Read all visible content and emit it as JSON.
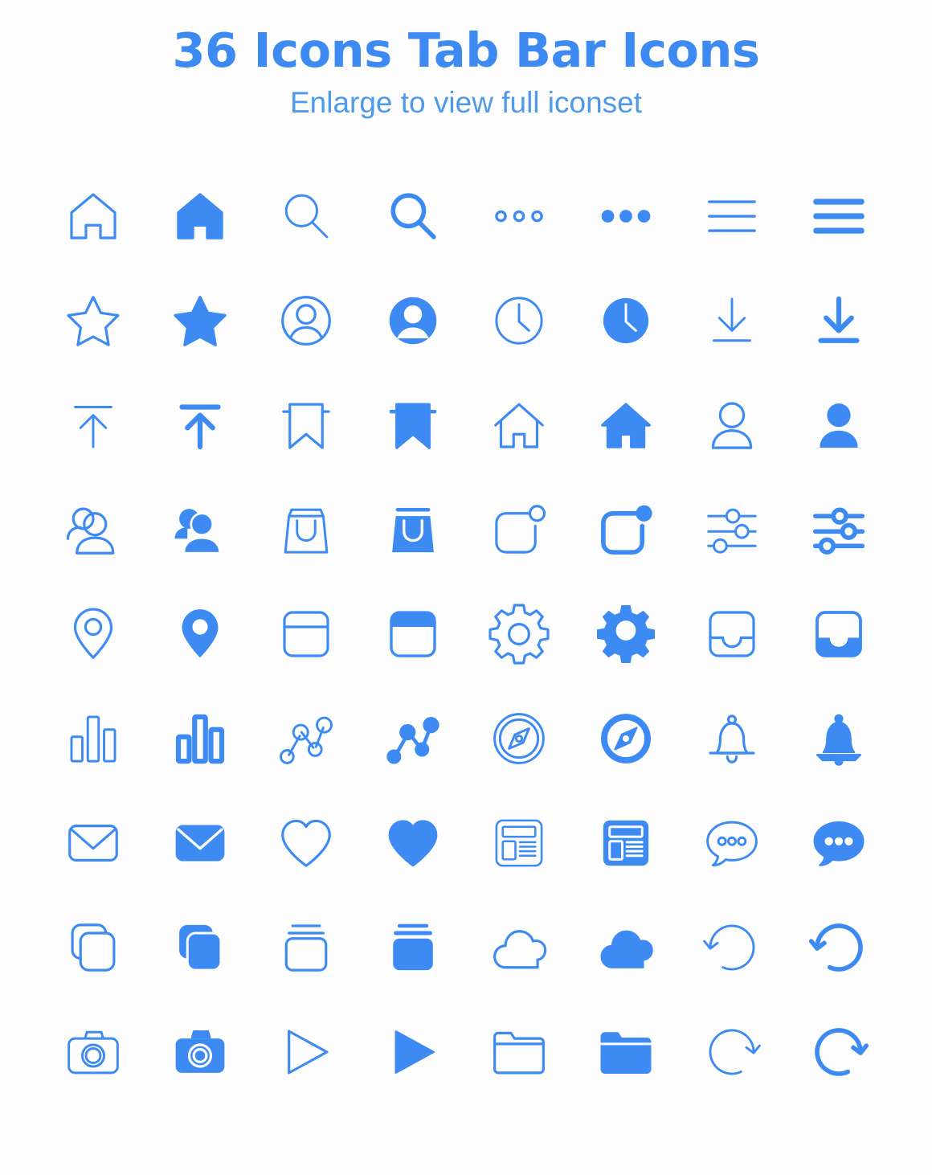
{
  "header": {
    "title": "36 Icons Tab Bar Icons",
    "subtitle": "Enlarge to view full iconset"
  },
  "theme": {
    "accent": "#3d8bf2",
    "accent_light": "#4f9ae8",
    "background": "#fdfdfe"
  },
  "grid": {
    "columns": 8,
    "rows": 9,
    "total_icons": 72,
    "icon_concepts": 36,
    "styles": [
      "outline",
      "filled"
    ]
  },
  "icons": [
    {
      "name": "home-icon",
      "label": "Home",
      "style": "outline"
    },
    {
      "name": "home-icon",
      "label": "Home",
      "style": "filled"
    },
    {
      "name": "search-icon",
      "label": "Search",
      "style": "outline"
    },
    {
      "name": "search-icon",
      "label": "Search",
      "style": "filled"
    },
    {
      "name": "more-horizontal-icon",
      "label": "More",
      "style": "outline"
    },
    {
      "name": "more-horizontal-icon",
      "label": "More",
      "style": "filled"
    },
    {
      "name": "menu-icon",
      "label": "Menu",
      "style": "outline"
    },
    {
      "name": "menu-icon",
      "label": "Menu",
      "style": "filled"
    },
    {
      "name": "star-icon",
      "label": "Star",
      "style": "outline"
    },
    {
      "name": "star-icon",
      "label": "Star",
      "style": "filled"
    },
    {
      "name": "account-circle-icon",
      "label": "Account",
      "style": "outline"
    },
    {
      "name": "account-circle-icon",
      "label": "Account",
      "style": "filled"
    },
    {
      "name": "clock-icon",
      "label": "Clock",
      "style": "outline"
    },
    {
      "name": "clock-icon",
      "label": "Clock",
      "style": "filled"
    },
    {
      "name": "download-icon",
      "label": "Download",
      "style": "outline"
    },
    {
      "name": "download-icon",
      "label": "Download",
      "style": "filled"
    },
    {
      "name": "upload-icon",
      "label": "Upload",
      "style": "outline"
    },
    {
      "name": "upload-icon",
      "label": "Upload",
      "style": "filled"
    },
    {
      "name": "bookmark-icon",
      "label": "Bookmark",
      "style": "outline"
    },
    {
      "name": "bookmark-icon",
      "label": "Bookmark",
      "style": "filled"
    },
    {
      "name": "house-roof-icon",
      "label": "House",
      "style": "outline"
    },
    {
      "name": "house-roof-icon",
      "label": "House",
      "style": "filled"
    },
    {
      "name": "person-icon",
      "label": "Person",
      "style": "outline"
    },
    {
      "name": "person-icon",
      "label": "Person",
      "style": "filled"
    },
    {
      "name": "people-group-icon",
      "label": "People",
      "style": "outline"
    },
    {
      "name": "people-group-icon",
      "label": "People",
      "style": "filled"
    },
    {
      "name": "shopping-bag-icon",
      "label": "Shopping Bag",
      "style": "outline"
    },
    {
      "name": "shopping-bag-icon",
      "label": "Shopping Bag",
      "style": "filled"
    },
    {
      "name": "notification-badge-icon",
      "label": "Notification Badge",
      "style": "outline"
    },
    {
      "name": "notification-badge-icon",
      "label": "Notification Badge",
      "style": "filled"
    },
    {
      "name": "sliders-icon",
      "label": "Settings Sliders",
      "style": "outline"
    },
    {
      "name": "sliders-icon",
      "label": "Settings Sliders",
      "style": "filled"
    },
    {
      "name": "map-pin-icon",
      "label": "Location",
      "style": "outline"
    },
    {
      "name": "map-pin-icon",
      "label": "Location",
      "style": "filled"
    },
    {
      "name": "calendar-icon",
      "label": "Calendar",
      "style": "outline"
    },
    {
      "name": "calendar-icon",
      "label": "Calendar",
      "style": "filled"
    },
    {
      "name": "gear-icon",
      "label": "Settings",
      "style": "outline"
    },
    {
      "name": "gear-icon",
      "label": "Settings",
      "style": "filled"
    },
    {
      "name": "inbox-icon",
      "label": "Inbox",
      "style": "outline"
    },
    {
      "name": "inbox-icon",
      "label": "Inbox",
      "style": "filled"
    },
    {
      "name": "bar-chart-icon",
      "label": "Statistics",
      "style": "outline"
    },
    {
      "name": "bar-chart-icon",
      "label": "Statistics",
      "style": "filled"
    },
    {
      "name": "network-nodes-icon",
      "label": "Network",
      "style": "outline"
    },
    {
      "name": "network-nodes-icon",
      "label": "Network",
      "style": "filled"
    },
    {
      "name": "compass-icon",
      "label": "Explore",
      "style": "outline"
    },
    {
      "name": "compass-icon",
      "label": "Explore",
      "style": "filled"
    },
    {
      "name": "bell-icon",
      "label": "Notifications",
      "style": "outline"
    },
    {
      "name": "bell-icon",
      "label": "Notifications",
      "style": "filled"
    },
    {
      "name": "mail-icon",
      "label": "Mail",
      "style": "outline"
    },
    {
      "name": "mail-icon",
      "label": "Mail",
      "style": "filled"
    },
    {
      "name": "heart-icon",
      "label": "Favorite",
      "style": "outline"
    },
    {
      "name": "heart-icon",
      "label": "Favorite",
      "style": "filled"
    },
    {
      "name": "news-article-icon",
      "label": "News",
      "style": "outline"
    },
    {
      "name": "news-article-icon",
      "label": "News",
      "style": "filled"
    },
    {
      "name": "chat-bubble-icon",
      "label": "Chat",
      "style": "outline"
    },
    {
      "name": "chat-bubble-icon",
      "label": "Chat",
      "style": "filled"
    },
    {
      "name": "copy-layers-icon",
      "label": "Copy",
      "style": "outline"
    },
    {
      "name": "copy-layers-icon",
      "label": "Copy",
      "style": "filled"
    },
    {
      "name": "archive-box-icon",
      "label": "Archive",
      "style": "outline"
    },
    {
      "name": "archive-box-icon",
      "label": "Archive",
      "style": "filled"
    },
    {
      "name": "cloud-icon",
      "label": "Cloud",
      "style": "outline"
    },
    {
      "name": "cloud-icon",
      "label": "Cloud",
      "style": "filled"
    },
    {
      "name": "undo-icon",
      "label": "Undo",
      "style": "outline"
    },
    {
      "name": "undo-icon",
      "label": "Undo",
      "style": "filled"
    },
    {
      "name": "camera-icon",
      "label": "Camera",
      "style": "outline"
    },
    {
      "name": "camera-icon",
      "label": "Camera",
      "style": "filled"
    },
    {
      "name": "play-icon",
      "label": "Play",
      "style": "outline"
    },
    {
      "name": "play-icon",
      "label": "Play",
      "style": "filled"
    },
    {
      "name": "folder-icon",
      "label": "Folder",
      "style": "outline"
    },
    {
      "name": "folder-icon",
      "label": "Folder",
      "style": "filled"
    },
    {
      "name": "redo-icon",
      "label": "Redo",
      "style": "outline"
    },
    {
      "name": "redo-icon",
      "label": "Redo",
      "style": "filled"
    }
  ]
}
